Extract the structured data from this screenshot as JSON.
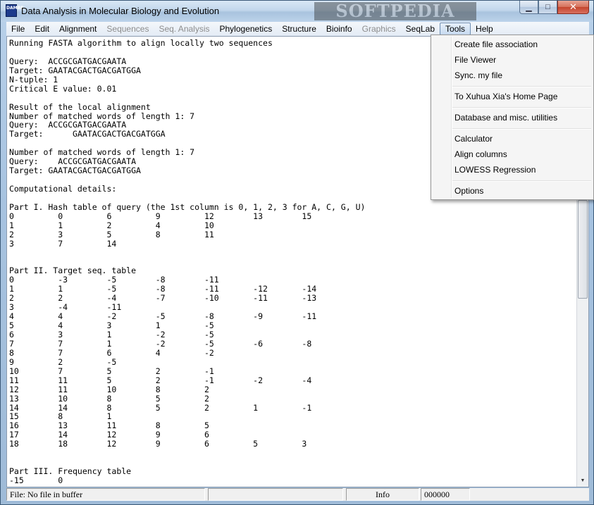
{
  "window": {
    "icon_text": "DAMBE",
    "title": "Data Analysis in Molecular Biology and Evolution",
    "watermark": "SOFTPEDIA",
    "minimize": "▁",
    "maximize": "□",
    "close": "✕"
  },
  "menubar": {
    "items": [
      {
        "label": "File",
        "disabled": false
      },
      {
        "label": "Edit",
        "disabled": false
      },
      {
        "label": "Alignment",
        "disabled": false
      },
      {
        "label": "Sequences",
        "disabled": true
      },
      {
        "label": "Seq. Analysis",
        "disabled": true
      },
      {
        "label": "Phylogenetics",
        "disabled": false
      },
      {
        "label": "Structure",
        "disabled": false
      },
      {
        "label": "Bioinfo",
        "disabled": false
      },
      {
        "label": "Graphics",
        "disabled": true
      },
      {
        "label": "SeqLab",
        "disabled": false
      },
      {
        "label": "Tools",
        "disabled": false,
        "active": true
      },
      {
        "label": "Help",
        "disabled": false
      }
    ]
  },
  "tools_menu": {
    "items": [
      "Create file association",
      "File Viewer",
      "Sync. my file",
      "To Xuhua Xia's Home Page",
      "Database and misc. utilities",
      "Calculator",
      "Align columns",
      "LOWESS Regression",
      "Options"
    ]
  },
  "output_lines": [
    "Running FASTA algorithm to align locally two sequences",
    "",
    "Query:  ACCGCGATGACGAATA",
    "Target: GAATACGACTGACGATGGA",
    "N-tuple: 1",
    "Critical E value: 0.01",
    "",
    "Result of the local alignment",
    "Number of matched words of length 1: 7",
    "Query:  ACCGCGATGACGAATA",
    "Target:      GAATACGACTGACGATGGA",
    "",
    "Number of matched words of length 1: 7",
    "Query:    ACCGCGATGACGAATA",
    "Target: GAATACGACTGACGATGGA",
    "",
    "Computational details:",
    "",
    "Part I. Hash table of query (the 1st column is 0, 1, 2, 3 for A, C, G, U)",
    "0         0         6         9         12        13        15",
    "1         1         2         4         10",
    "2         3         5         8         11",
    "3         7         14",
    "",
    "",
    "Part II. Target seq. table",
    "0         -3        -5        -8        -11",
    "1         1         -5        -8        -11       -12       -14",
    "2         2         -4        -7        -10       -11       -13",
    "3         -4        -11",
    "4         4         -2        -5        -8        -9        -11",
    "5         4         3         1         -5",
    "6         3         1         -2        -5",
    "7         7         1         -2        -5        -6        -8",
    "8         7         6         4         -2",
    "9         2         -5",
    "10        7         5         2         -1",
    "11        11        5         2         -1        -2        -4",
    "12        11        10        8         2",
    "13        10        8         5         2",
    "14        14        8         5         2         1         -1",
    "15        8         1",
    "16        13        11        8         5",
    "17        14        12        9         6",
    "18        18        12        9         6         5         3",
    "",
    "",
    "Part III. Frequency table",
    "-15       0"
  ],
  "statusbar": {
    "file": "File: No file in buffer",
    "field2": "",
    "info": "Info",
    "counter": "000000"
  }
}
